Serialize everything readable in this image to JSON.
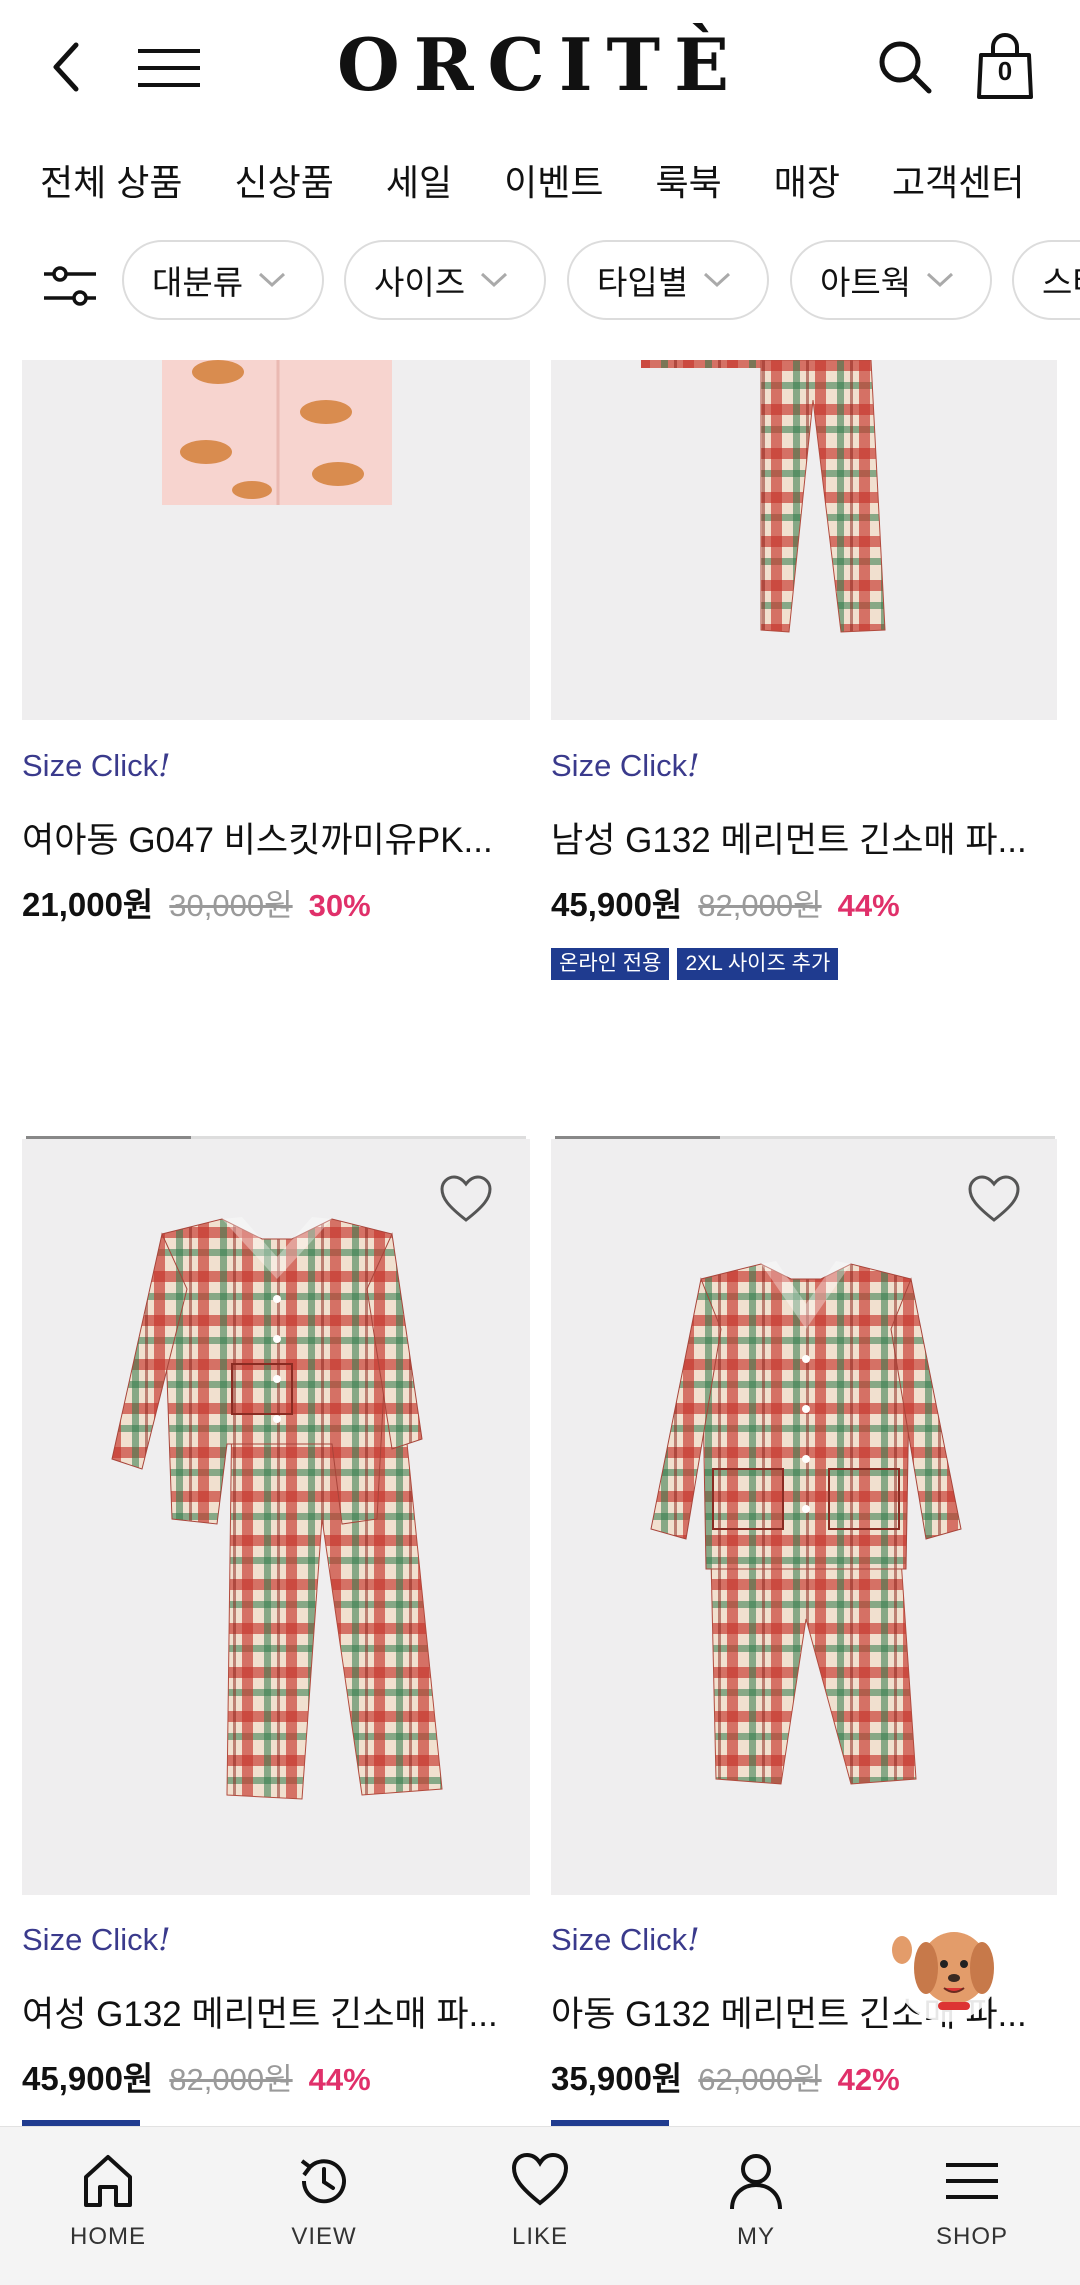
{
  "brand": {
    "logo_text": "ORCITÈ"
  },
  "header": {
    "bag_count": "0"
  },
  "category_nav": [
    "전체 상품",
    "신상품",
    "세일",
    "이벤트",
    "룩북",
    "매장",
    "고객센터"
  ],
  "filters": [
    "대분류",
    "사이즈",
    "타입별",
    "아트웍",
    "스타"
  ],
  "products": [
    {
      "size_click": "Size Click",
      "size_click_mark": "!",
      "name": "여아동 G047 비스킷까미유PK...",
      "price": "21,000원",
      "original_price": "30,000원",
      "discount": "30%",
      "badges": []
    },
    {
      "size_click": "Size Click",
      "size_click_mark": "!",
      "name": "남성 G132 메리먼트 긴소매 파...",
      "price": "45,900원",
      "original_price": "82,000원",
      "discount": "44%",
      "badges": [
        "온라인 전용",
        "2XL 사이즈 추가"
      ]
    },
    {
      "size_click": "Size Click",
      "size_click_mark": "!",
      "name": "여성 G132 메리먼트 긴소매 파...",
      "price": "45,900원",
      "original_price": "82,000원",
      "discount": "44%",
      "badges": []
    },
    {
      "size_click": "Size Click",
      "size_click_mark": "!",
      "name": "아동 G132 메리먼트 긴소매 파...",
      "price": "35,900원",
      "original_price": "62,000원",
      "discount": "42%",
      "badges": []
    }
  ],
  "image_carousel": {
    "current_slide_fraction": 0.33
  },
  "bottom_nav": [
    {
      "label": "HOME",
      "icon": "home-icon"
    },
    {
      "label": "VIEW",
      "icon": "history-icon"
    },
    {
      "label": "LIKE",
      "icon": "heart-icon"
    },
    {
      "label": "MY",
      "icon": "user-icon"
    },
    {
      "label": "SHOP",
      "icon": "menu-icon"
    }
  ],
  "colors": {
    "accent_blue": "#1f3b8f",
    "discount_pink": "#e0306a",
    "size_click_purple": "#3a3a8c",
    "image_bg": "#efeeef"
  }
}
